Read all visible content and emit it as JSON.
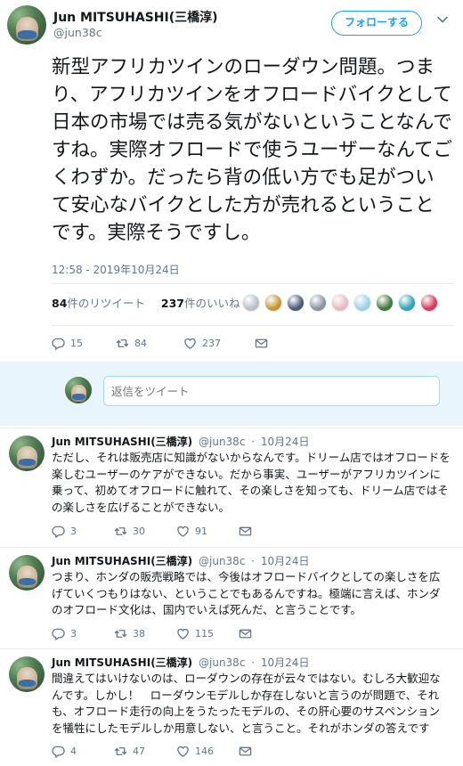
{
  "header": {
    "name": "Jun MITSUHASHI(三橋淳)",
    "handle": "@jun38c",
    "follow_label": "フォローする"
  },
  "main_tweet": {
    "text": "新型アフリカツインのローダウン問題。つまり、アフリカツインをオフロードバイクとして日本の市場では売る気がないということなんですね。実際オフロードで使うユーザーなんてごくわずか。だったら背の低い方でも足がついて安心なバイクとした方が売れるということです。実際そうですし。",
    "timestamp": "12:58 - 2019年10月24日",
    "retweets_count": "84",
    "retweets_label": "件のリツイート",
    "likes_count": "237",
    "likes_label": "件のいいね",
    "replies": "15",
    "retweets": "84",
    "likes": "237"
  },
  "likers_colors": [
    "#b8bfc6",
    "#c9962c",
    "#4a5b75",
    "#8c94a1",
    "#e8b9c2",
    "#9ad0ea",
    "#3f7a3a",
    "#2fa3b8",
    "#d83a5a"
  ],
  "reply_box": {
    "placeholder": "返信をツイート"
  },
  "replies": [
    {
      "name": "Jun MITSUHASHI(三橋淳)",
      "handle": "@jun38c",
      "date": "10月24日",
      "text": "ただし、それは販売店に知識がないからなんです。ドリーム店ではオフロードを楽しむユーザーのケアができない。だから事実、ユーザーがアフリカツインに乗って、初めてオフロードに触れて、その楽しさを知っても、ドリーム店ではその楽しさを広げることができない。",
      "replies": "3",
      "retweets": "30",
      "likes": "91"
    },
    {
      "name": "Jun MITSUHASHI(三橋淳)",
      "handle": "@jun38c",
      "date": "10月24日",
      "text": "つまり、ホンダの販売戦略では、今後はオフロードバイクとしての楽しさを広げていくつもりはない、ということでもあるんですね。極端に言えば、ホンダのオフロード文化は、国内でいえば死んだ、と言うことです。",
      "replies": "3",
      "retweets": "38",
      "likes": "115"
    },
    {
      "name": "Jun MITSUHASHI(三橋淳)",
      "handle": "@jun38c",
      "date": "10月24日",
      "text": "間違えてはいけないのは、ローダウンの存在が云々ではない。むしろ大歓迎なんです。しかし！　ローダウンモデルしか存在しないと言うのが問題で、それも、オフロード走行の向上をうたったモデルの、その肝心要のサスペンションを犠牲にしたモデルしか用意しない、と言うこと。それがホンダの答えです",
      "replies": "4",
      "retweets": "47",
      "likes": "146"
    }
  ]
}
